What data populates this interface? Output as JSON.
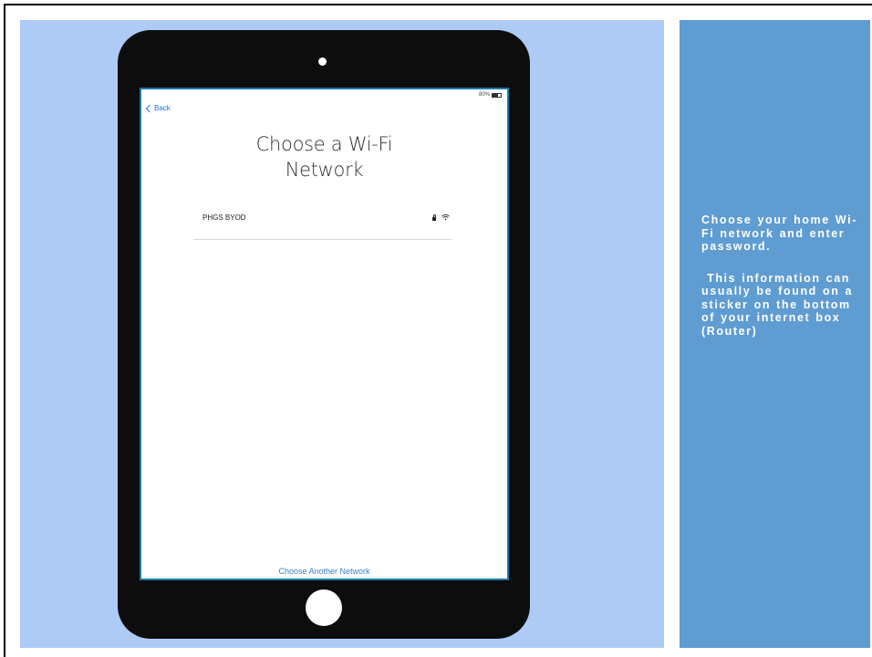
{
  "slide": {
    "caption_lines": [
      "Choose your home Wi-Fi network and enter password.",
      " This information can usually be found on a sticker on the bottom of your internet box (Router)"
    ]
  },
  "ipad": {
    "status_bar": {
      "battery_text": "80%"
    },
    "back_label": "Back",
    "title": "Choose a Wi-Fi Network",
    "networks": [
      {
        "name": "PHGS BYOD",
        "secured": true,
        "icon": "wifi-icon"
      }
    ],
    "choose_another_label": "Choose Another Network"
  },
  "colors": {
    "left_panel": "#aecbf5",
    "right_panel": "#5f9cd2",
    "screen_border": "#1f78a6",
    "link_blue": "#3a82c6"
  }
}
